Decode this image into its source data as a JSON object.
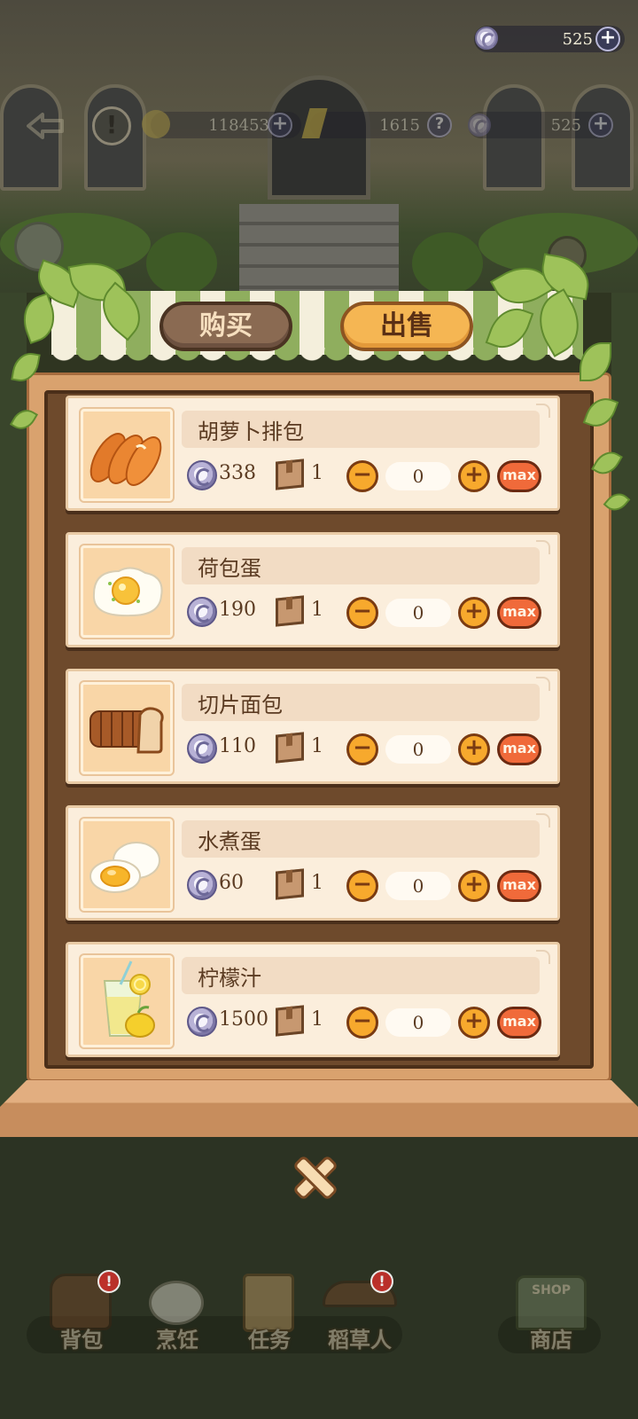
{
  "top_bar": {
    "silver": "525"
  },
  "bg_bar": {
    "gold": "118453",
    "crystal": "1615",
    "silver": "525",
    "help": "?",
    "alert": "!"
  },
  "tabs": {
    "buy": "购买",
    "sell": "出售",
    "active": "sell"
  },
  "items": [
    {
      "name": "胡萝卜排包",
      "price": "338",
      "stock": "1",
      "qty": "0",
      "max_label": "max",
      "icon": "carrot-bread-icon"
    },
    {
      "name": "荷包蛋",
      "price": "190",
      "stock": "1",
      "qty": "0",
      "max_label": "max",
      "icon": "fried-egg-icon"
    },
    {
      "name": "切片面包",
      "price": "110",
      "stock": "1",
      "qty": "0",
      "max_label": "max",
      "icon": "sliced-bread-icon"
    },
    {
      "name": "水煮蛋",
      "price": "60",
      "stock": "1",
      "qty": "0",
      "max_label": "max",
      "icon": "boiled-egg-icon"
    },
    {
      "name": "柠檬汁",
      "price": "1500",
      "stock": "1",
      "qty": "0",
      "max_label": "max",
      "icon": "lemon-juice-icon"
    }
  ],
  "bottom_nav": [
    {
      "label": "背包",
      "icon": "backpack-icon",
      "badge": "!"
    },
    {
      "label": "烹饪",
      "icon": "cooking-icon",
      "badge": ""
    },
    {
      "label": "任务",
      "icon": "task-clipboard-icon",
      "badge": ""
    },
    {
      "label": "稻草人",
      "icon": "scarecrow-icon",
      "badge": "!"
    },
    {
      "label": "商店",
      "icon": "shop-icon",
      "badge": "",
      "sign": "SHOP"
    }
  ],
  "colors": {
    "accent_orange": "#f5b653",
    "max_red": "#f06a3a",
    "panel_wood": "#d9a26e",
    "card_bg": "#fbeedc"
  }
}
